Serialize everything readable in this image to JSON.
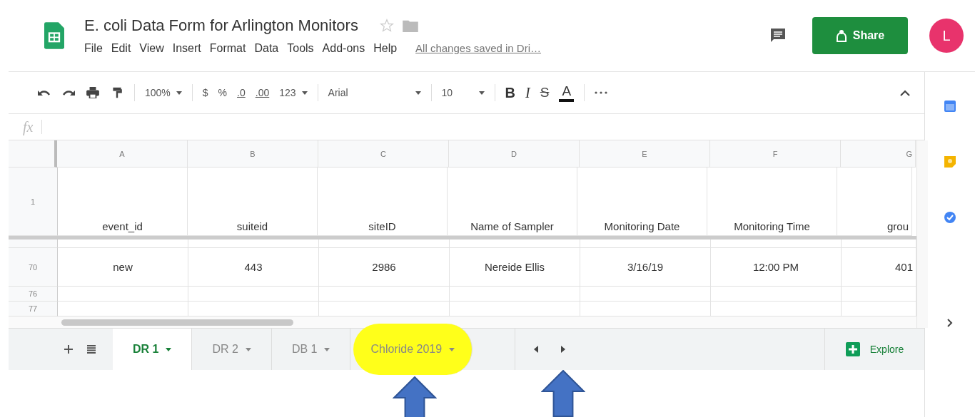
{
  "doc": {
    "title": "E. coli Data Form for Arlington Monitors",
    "starred": false,
    "menu": [
      "File",
      "Edit",
      "View",
      "Insert",
      "Format",
      "Data",
      "Tools",
      "Add-ons",
      "Help"
    ],
    "save_status": "All changes saved in Dri…"
  },
  "share": "Share",
  "avatar": "L",
  "toolbar": {
    "zoom": "100%",
    "currency": "$",
    "percent": "%",
    "dec_less": ".0",
    "dec_more": ".00",
    "number_format": "123",
    "font": "Arial",
    "size": "10",
    "bold": "B",
    "italic": "I",
    "strike": "S",
    "text_color": "A"
  },
  "formula": {
    "label": "fx"
  },
  "columns": [
    "A",
    "B",
    "C",
    "D",
    "E",
    "F",
    "G"
  ],
  "header_row": {
    "num": "1",
    "cells": [
      "event_id",
      "suiteid",
      "siteID",
      "Name of Sampler",
      "Monitoring Date",
      "Monitoring Time",
      "grou"
    ]
  },
  "rows": [
    {
      "num": "70",
      "cells": [
        "new",
        "443",
        "2986",
        "Nereide Ellis",
        "3/16/19",
        "12:00 PM",
        "401"
      ]
    },
    {
      "num": "76",
      "cells": []
    },
    {
      "num": "77",
      "cells": []
    }
  ],
  "sheets": [
    {
      "label": "DR 1",
      "selected": true,
      "highlighted": false,
      "arrow": false
    },
    {
      "label": "DR 2",
      "selected": false,
      "highlighted": false,
      "arrow": false
    },
    {
      "label": "DB 1",
      "selected": false,
      "highlighted": false,
      "arrow": false
    },
    {
      "label": "Chloride 2019",
      "selected": false,
      "highlighted": true,
      "arrow": true
    }
  ],
  "tab_scroll": {
    "arrow_on_next": true
  },
  "explore": "Explore"
}
